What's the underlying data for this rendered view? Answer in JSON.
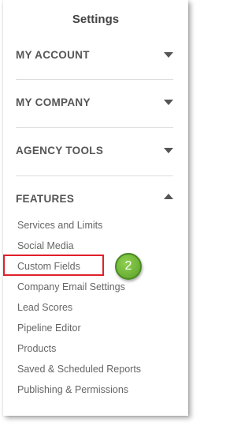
{
  "panel": {
    "title": "Settings"
  },
  "sections": [
    {
      "label": "MY ACCOUNT",
      "expanded": false
    },
    {
      "label": "MY COMPANY",
      "expanded": false
    },
    {
      "label": "AGENCY TOOLS",
      "expanded": false
    },
    {
      "label": "FEATURES",
      "expanded": true
    }
  ],
  "features": {
    "items": [
      "Services and Limits",
      "Social Media",
      "Custom Fields",
      "Company Email Settings",
      "Lead Scores",
      "Pipeline Editor",
      "Products",
      "Saved & Scheduled Reports",
      "Publishing & Permissions"
    ],
    "highlighted_item": "Custom Fields"
  },
  "annotation": {
    "step_number": "2",
    "highlight_color": "#e0202a",
    "badge_color": "#6ab531"
  }
}
